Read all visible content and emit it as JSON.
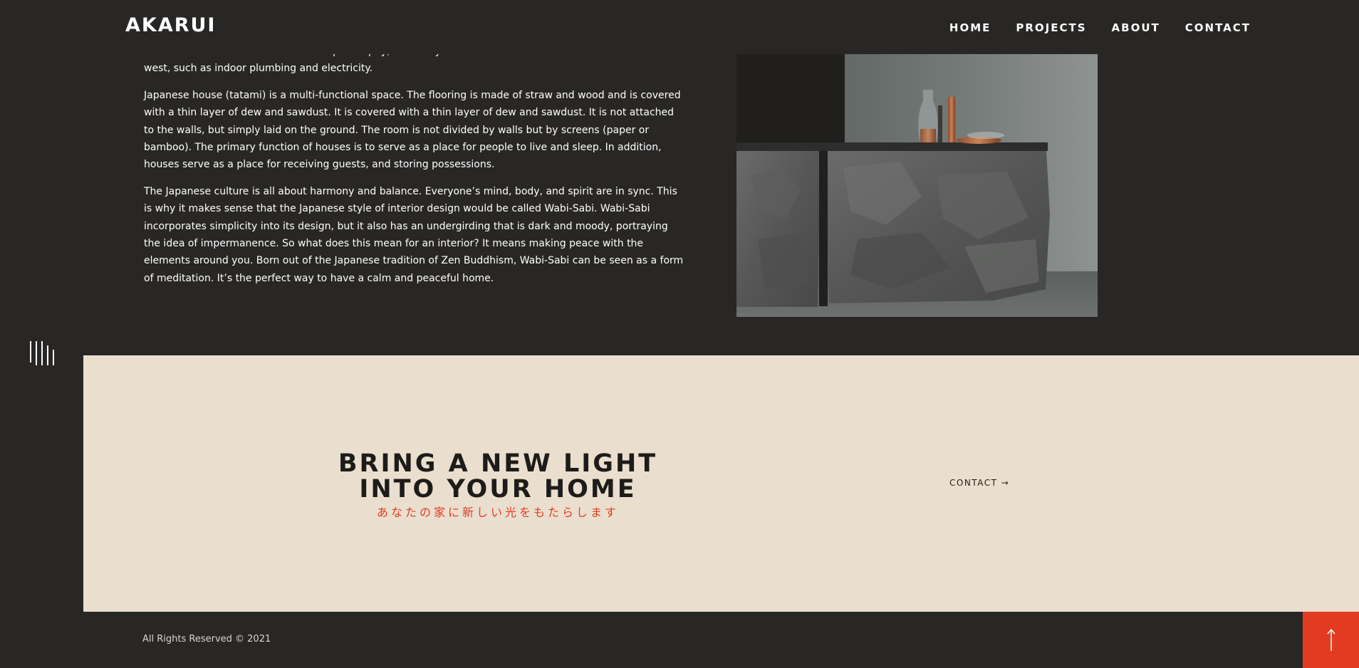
{
  "header": {
    "logo": "AKARUI",
    "nav": [
      "HOME",
      "PROJECTS",
      "ABOUT",
      "CONTACT"
    ]
  },
  "article": {
    "paragraphs": [
      "Modern homes still follow this overall philosophy, but many have been renovated with amenities from the west, such as indoor plumbing and electricity.",
      "Japanese house (tatami) is a multi-functional space. The flooring is made of straw and wood and is covered with a thin layer of dew and sawdust. It is covered with a thin layer of dew and sawdust. It is not attached to the walls, but simply laid on the ground. The room is not divided by walls but by screens (paper or bamboo). The primary function of houses is to serve as a place for people to live and sleep. In addition, houses serve as a place for receiving guests, and storing possessions.",
      "The Japanese culture is all about harmony and balance. Everyone’s mind, body, and spirit are in sync. This is why it makes sense that the Japanese style of interior design would be called Wabi-Sabi. Wabi-Sabi incorporates simplicity into its design, but it also has an undergirding that is dark and moody, portraying the idea of impermanence. So what does this mean for an interior? It means making peace with the elements around you. Born out of the Japanese tradition of Zen Buddhism, Wabi-Sabi can be seen as a form of meditation. It’s the perfect way to have a calm and peaceful home."
    ]
  },
  "cta": {
    "title_line1": "BRING A NEW LIGHT",
    "title_line2": "INTO YOUR HOME",
    "subtitle": "あなたの家に新しい光をもたらします",
    "link": "CONTACT →"
  },
  "footer": {
    "copyright": "All Rights Reserved © 2021"
  },
  "icons": {
    "side": "vertical-lines-icon",
    "to_top": "arrow-up-icon"
  },
  "colors": {
    "background": "#282725",
    "accent": "#e23b22",
    "cta_background": "#eadfce"
  }
}
